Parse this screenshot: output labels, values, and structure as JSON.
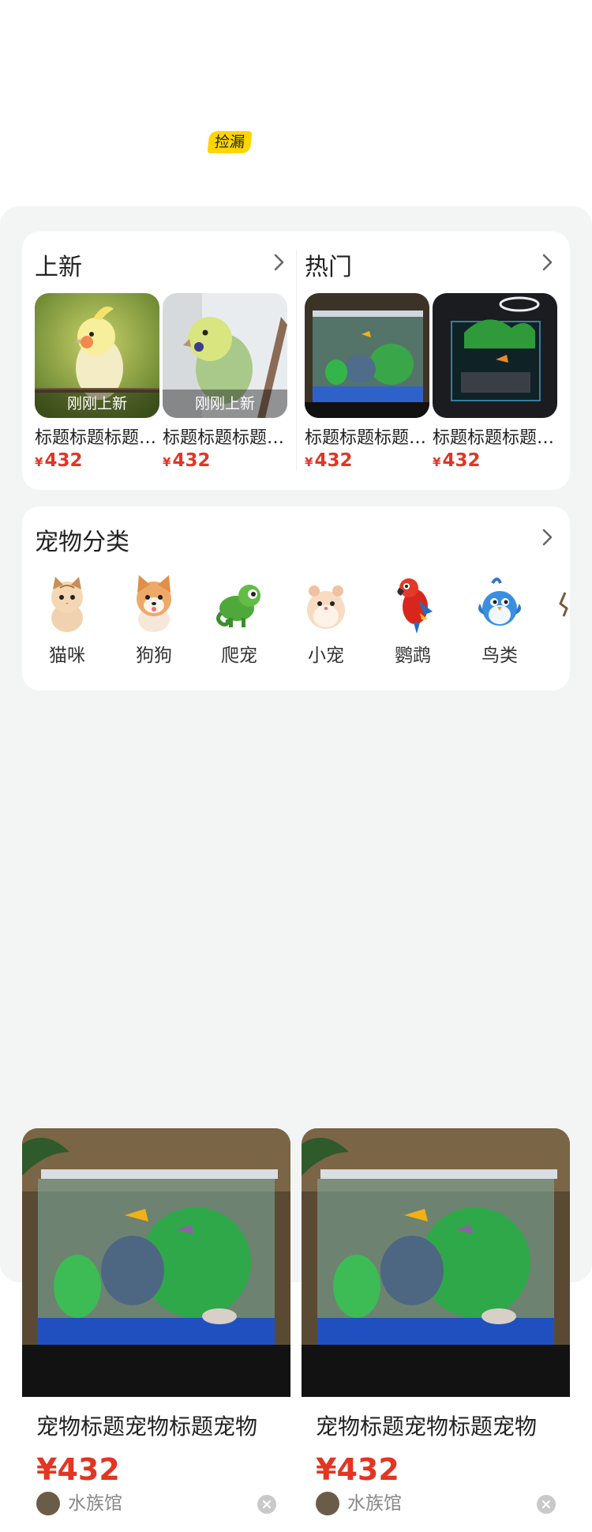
{
  "header": {
    "tag": "捡漏"
  },
  "new_section": {
    "title": "上新",
    "items": [
      {
        "badge": "刚刚上新",
        "title": "标题标题标题标题",
        "yen": "¥",
        "price": "432",
        "image": "cockatiel-photo"
      },
      {
        "badge": "刚刚上新",
        "title": "标题标题标题标题",
        "yen": "¥",
        "price": "432",
        "image": "budgie-photo"
      }
    ]
  },
  "hot_section": {
    "title": "热门",
    "items": [
      {
        "title": "标题标题标题标题",
        "yen": "¥",
        "price": "432",
        "image": "aquarium-photo"
      },
      {
        "title": "标题标题标题标题",
        "yen": "¥",
        "price": "432",
        "image": "dark-aquarium-photo"
      }
    ]
  },
  "categories": {
    "title": "宠物分类",
    "items": [
      {
        "label": "猫咪",
        "icon": "cat-icon"
      },
      {
        "label": "狗狗",
        "icon": "dog-icon"
      },
      {
        "label": "爬宠",
        "icon": "chameleon-icon"
      },
      {
        "label": "小宠",
        "icon": "hamster-icon"
      },
      {
        "label": "鹦鹉",
        "icon": "parrot-icon"
      },
      {
        "label": "鸟类",
        "icon": "bird-icon"
      }
    ]
  },
  "feed": [
    {
      "title": "宠物标题宠物标题宠物",
      "price": "¥432",
      "shop": "水族馆"
    },
    {
      "title": "宠物标题宠物标题宠物",
      "price": "¥432",
      "shop": "水族馆"
    }
  ],
  "colors": {
    "accent_price": "#E33522",
    "tag_yellow": "#FFD500",
    "panel_bg": "#F3F4F4"
  }
}
